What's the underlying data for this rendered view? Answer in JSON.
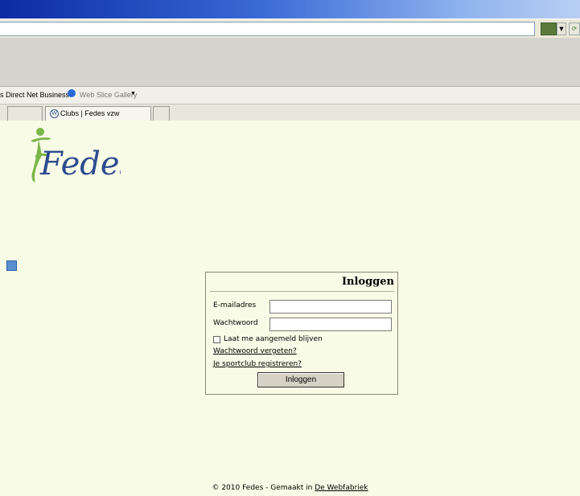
{
  "browser": {
    "favorites_bar": {
      "items": [
        {
          "label": "s Direct Net Business"
        },
        {
          "label": "Web Slice Gallery"
        }
      ]
    },
    "tabs": [
      {
        "label": "Clubs | Fedes vzw"
      }
    ]
  },
  "page": {
    "logo_text": "Fedes",
    "login": {
      "title": "Inloggen",
      "email_label": "E-mailadres",
      "email_value": "",
      "password_label": "Wachtwoord",
      "password_value": "",
      "remember_label": "Laat me aangemeld blijven",
      "forgot_link": "Wachtwoord vergeten?",
      "register_link": "Je sportclub registreren?",
      "submit_label": "Inloggen"
    },
    "footer": {
      "text": "© 2010 Fedes - Gemaakt in",
      "link": "De Webfabriek"
    }
  },
  "colors": {
    "page_background": "#f8fbe6",
    "logo_green": "#7ab648",
    "logo_blue": "#2c4a8f"
  }
}
